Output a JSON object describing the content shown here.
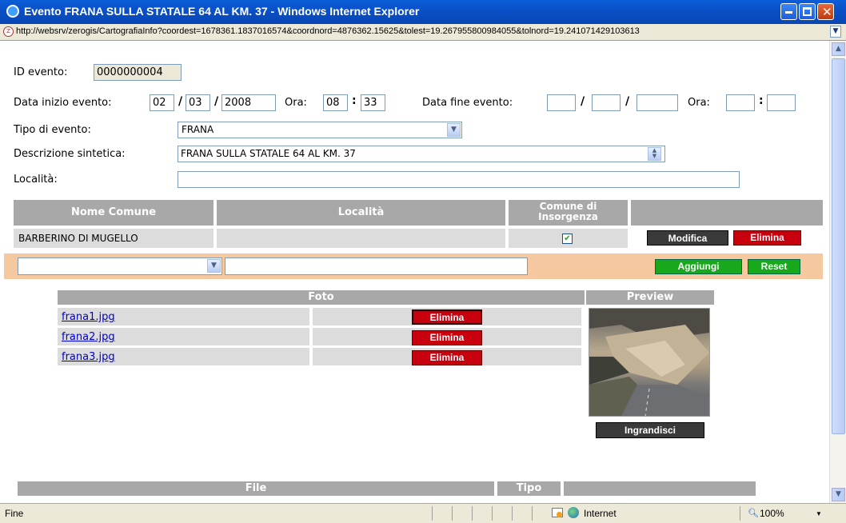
{
  "window": {
    "title": "Evento FRANA SULLA STATALE 64 AL KM. 37 - Windows Internet Explorer",
    "url": "http://websrv/zerogis/CartografiaInfo?coordest=1678361.1837016574&coordnord=4876362.15625&tolest=19.267955800984055&tolnord=19.241071429103613"
  },
  "form": {
    "id_label": "ID evento:",
    "id_value": "0000000004",
    "start_label": "Data inizio evento:",
    "start_day": "02",
    "start_month": "03",
    "start_year": "2008",
    "ora_label": "Ora:",
    "start_hour": "08",
    "start_min": "33",
    "end_label": "Data fine evento:",
    "end_ora_label": "Ora:",
    "tipo_label": "Tipo di evento:",
    "tipo_value": "FRANA",
    "desc_label": "Descrizione sintetica:",
    "desc_value": "FRANA SULLA STATALE 64 AL KM. 37",
    "localita_label": "Località:",
    "localita_value": ""
  },
  "comuni_table": {
    "headers": [
      "Nome Comune",
      "Località",
      "Comune di Insorgenza",
      ""
    ],
    "rows": [
      {
        "comune": "BARBERINO DI MUGELLO",
        "localita": "",
        "insorgenza": true
      }
    ],
    "modifica_label": "Modifica",
    "elimina_label": "Elimina",
    "aggiungi_label": "Aggiungi",
    "reset_label": "Reset"
  },
  "foto_table": {
    "header_foto": "Foto",
    "header_preview": "Preview",
    "files": [
      "frana1.jpg",
      "frana2.jpg",
      "frana3.jpg"
    ],
    "elimina_label": "Elimina",
    "ingrandisci_label": "Ingrandisci"
  },
  "file_table": {
    "header_file": "File",
    "header_tipo": "Tipo"
  },
  "statusbar": {
    "status": "Fine",
    "zone": "Internet",
    "zoom": "100%"
  },
  "colors": {
    "titlebar": "#0a4fc4",
    "table_header": "#a8a8a8",
    "delete_button": "#c8000e",
    "add_button": "#17a81b",
    "add_row_bg": "#f5c8a0"
  }
}
